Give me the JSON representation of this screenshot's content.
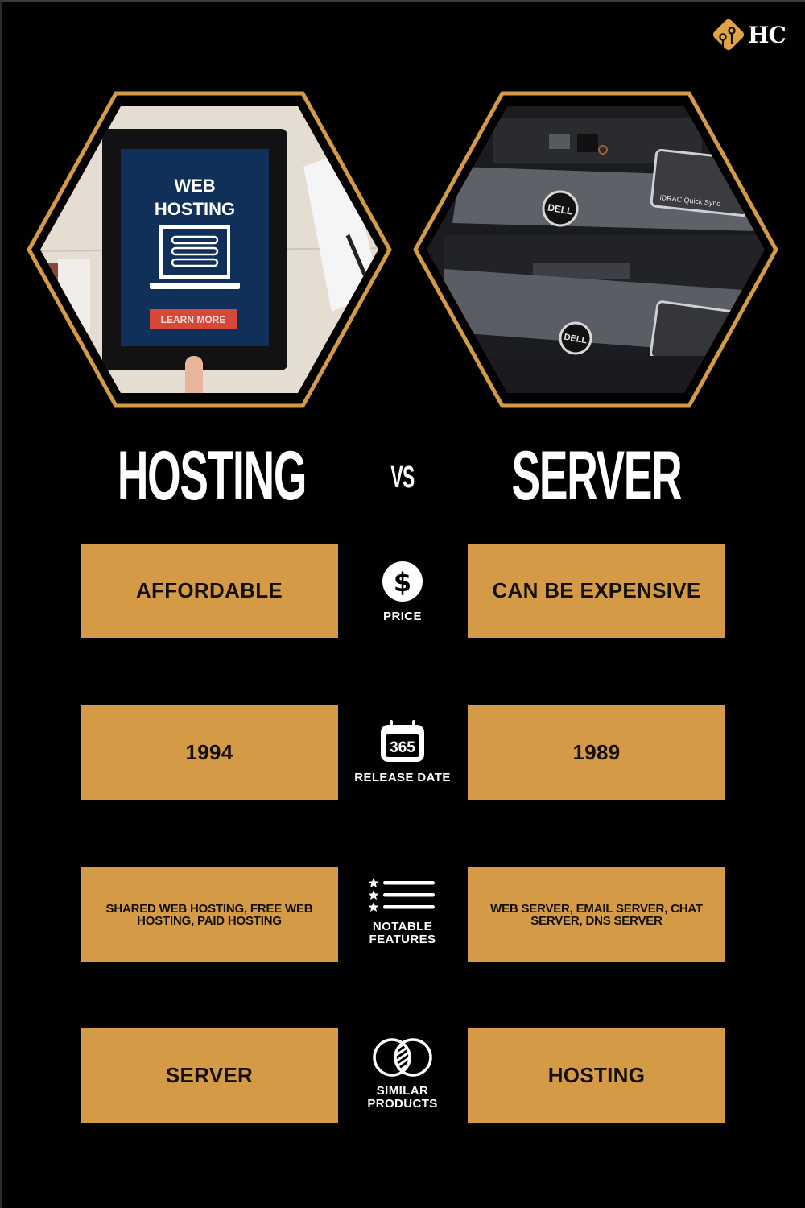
{
  "brand": {
    "logo_text": "HC",
    "logo_icon": "circuit-nodes-icon",
    "accent_color": "#d49a45",
    "background_color": "#010101"
  },
  "images": {
    "left": {
      "alt": "Tablet showing web hosting page",
      "screen_title_line1": "WEB",
      "screen_title_line2": "HOSTING",
      "screen_button": "LEARN MORE"
    },
    "right": {
      "alt": "Dell rack servers",
      "badge_text": "DELL",
      "panel_text": "iDRAC Quick Sync"
    }
  },
  "header": {
    "left_title": "HOSTING",
    "vs_label": "VS",
    "right_title": "SERVER"
  },
  "rows": [
    {
      "category": "PRICE",
      "icon": "dollar-circle-icon",
      "left": "AFFORDABLE",
      "right": "CAN BE EXPENSIVE"
    },
    {
      "category": "RELEASE DATE",
      "icon": "calendar-icon",
      "icon_text": "365",
      "left": "1994",
      "right": "1989"
    },
    {
      "category_line1": "NOTABLE",
      "category_line2": "FEATURES",
      "icon": "starred-list-icon",
      "left": "SHARED WEB HOSTING, FREE WEB HOSTING, PAID HOSTING",
      "right": "WEB SERVER, EMAIL SERVER, CHAT SERVER, DNS SERVER"
    },
    {
      "category_line1": "SIMILAR",
      "category_line2": "PRODUCTS",
      "icon": "overlapping-circles-icon",
      "left": "SERVER",
      "right": "HOSTING"
    }
  ]
}
